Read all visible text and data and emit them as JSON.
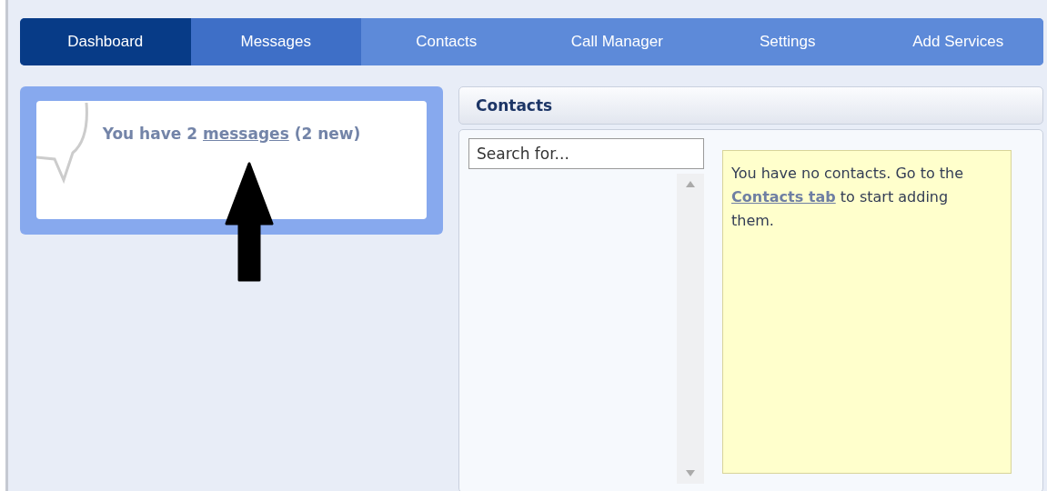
{
  "tabs": [
    {
      "label": "Dashboard",
      "selected": true,
      "hovered": false
    },
    {
      "label": "Messages",
      "selected": false,
      "hovered": true
    },
    {
      "label": "Contacts",
      "selected": false,
      "hovered": false
    },
    {
      "label": "Call Manager",
      "selected": false,
      "hovered": false
    },
    {
      "label": "Settings",
      "selected": false,
      "hovered": false
    },
    {
      "label": "Add Services",
      "selected": false,
      "hovered": false
    }
  ],
  "messages_widget": {
    "before": "You have 2",
    "link": "messages",
    "after": "(2 new)"
  },
  "contacts_panel": {
    "title": "Contacts",
    "search": {
      "placeholder": "Search for..."
    },
    "note": {
      "before": "You have no contacts. Go to the",
      "link": "Contacts tab",
      "after": "to start adding them."
    }
  }
}
